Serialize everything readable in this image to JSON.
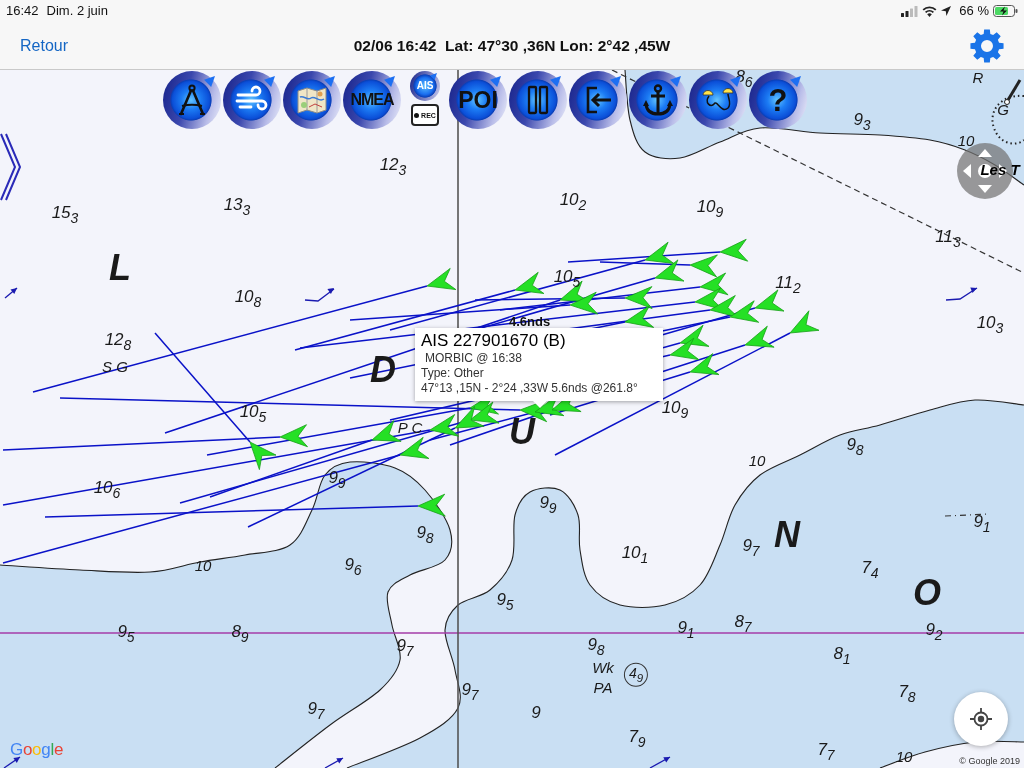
{
  "status_bar": {
    "time": "16:42",
    "date": "Dim. 2 juin",
    "battery": "66 %"
  },
  "nav_bar": {
    "back": "Retour",
    "title": "02/06 16:42  Lat: 47°30 ,36N Lon: 2°42 ,45W"
  },
  "toolbar": [
    {
      "kind": "dividers"
    },
    {
      "kind": "wind"
    },
    {
      "kind": "chart"
    },
    {
      "kind": "nmea",
      "label": "NMEA"
    },
    {
      "kind": "ais",
      "label": "AIS",
      "rec_label": "REC"
    },
    {
      "kind": "poi",
      "label": "POI"
    },
    {
      "kind": "pause"
    },
    {
      "kind": "exit"
    },
    {
      "kind": "anchor"
    },
    {
      "kind": "route"
    },
    {
      "kind": "help",
      "label": "?"
    }
  ],
  "chart_labels": [
    {
      "text": "8$_{6}$",
      "kind": "depth"
    },
    {
      "text": "R",
      "kind": "name"
    },
    {
      "text": "9$_{3}$",
      "kind": "depth"
    },
    {
      "text": "G",
      "kind": "name"
    },
    {
      "text": "10",
      "kind": "contour"
    },
    {
      "text": "12$_{3}$",
      "kind": "depth"
    },
    {
      "text": "Les T",
      "kind": "name"
    },
    {
      "text": "15$_{3}$",
      "kind": "depth"
    },
    {
      "text": "13$_{3}$",
      "kind": "depth"
    },
    {
      "text": "10$_{2}$",
      "kind": "depth"
    },
    {
      "text": "10$_{9}$",
      "kind": "depth"
    },
    {
      "text": "11$_{3}$",
      "kind": "depth"
    },
    {
      "text": "L",
      "kind": "area"
    },
    {
      "text": "10$_{8}$",
      "kind": "depth"
    },
    {
      "text": "10$_{5}$",
      "kind": "depth"
    },
    {
      "text": "11$_{2}$",
      "kind": "depth"
    },
    {
      "text": "10$_{3}$",
      "kind": "depth"
    },
    {
      "text": "12$_{8}$",
      "kind": "depth"
    },
    {
      "text": "S G",
      "kind": "name"
    },
    {
      "text": "D",
      "kind": "area"
    },
    {
      "text": "10$_{5}$",
      "kind": "depth"
    },
    {
      "text": "P C",
      "kind": "name"
    },
    {
      "text": "U",
      "kind": "area"
    },
    {
      "text": "10$_{9}$",
      "kind": "depth"
    },
    {
      "text": "10",
      "kind": "contour"
    },
    {
      "text": "9$_{8}$",
      "kind": "depth"
    },
    {
      "text": "10$_{6}$",
      "kind": "depth"
    },
    {
      "text": "9$_{9}$",
      "kind": "depth"
    },
    {
      "text": "9$_{9}$",
      "kind": "depth"
    },
    {
      "text": "9$_{8}$",
      "kind": "depth"
    },
    {
      "text": "10$_{1}$",
      "kind": "depth"
    },
    {
      "text": "9$_{7}$",
      "kind": "depth"
    },
    {
      "text": "N",
      "kind": "area"
    },
    {
      "text": "9$_{1}$",
      "kind": "depth"
    },
    {
      "text": "10",
      "kind": "contour"
    },
    {
      "text": "9$_{6}$",
      "kind": "depth"
    },
    {
      "text": "9$_{5}$",
      "kind": "depth"
    },
    {
      "text": "7$_{4}$",
      "kind": "depth"
    },
    {
      "text": "O",
      "kind": "area"
    },
    {
      "text": "9$_{5}$",
      "kind": "depth"
    },
    {
      "text": "8$_{9}$",
      "kind": "depth"
    },
    {
      "text": "9$_{7}$",
      "kind": "depth"
    },
    {
      "text": "9$_{8}$",
      "kind": "depth"
    },
    {
      "text": "9$_{1}$",
      "kind": "depth"
    },
    {
      "text": "8$_{7}$",
      "kind": "depth"
    },
    {
      "text": "8$_{1}$",
      "kind": "depth"
    },
    {
      "text": "9$_{2}$",
      "kind": "depth"
    },
    {
      "text": "Wk",
      "kind": "name"
    },
    {
      "text": "4$_{9}$",
      "kind": "circled"
    },
    {
      "text": "9$_{7}$",
      "kind": "depth"
    },
    {
      "text": "PA",
      "kind": "name"
    },
    {
      "text": "7$_{8}$",
      "kind": "depth"
    },
    {
      "text": "9$_{7}$",
      "kind": "depth"
    },
    {
      "text": "9",
      "kind": "depth"
    },
    {
      "text": "7$_{9}$",
      "kind": "depth"
    },
    {
      "text": "7$_{7}$",
      "kind": "depth"
    },
    {
      "text": "10",
      "kind": "contour"
    }
  ],
  "speed_label": "4.6nds",
  "ais_popup": {
    "title": "AIS 227901670 (B)",
    "lines": [
      "MORBIC @ 16:38",
      "Type: Other",
      "47°13 ,15N - 2°24 ,33W 5.6nds @261.8°"
    ]
  },
  "map_footer": {
    "logo": "Google",
    "copyright": "© Google 2019"
  }
}
